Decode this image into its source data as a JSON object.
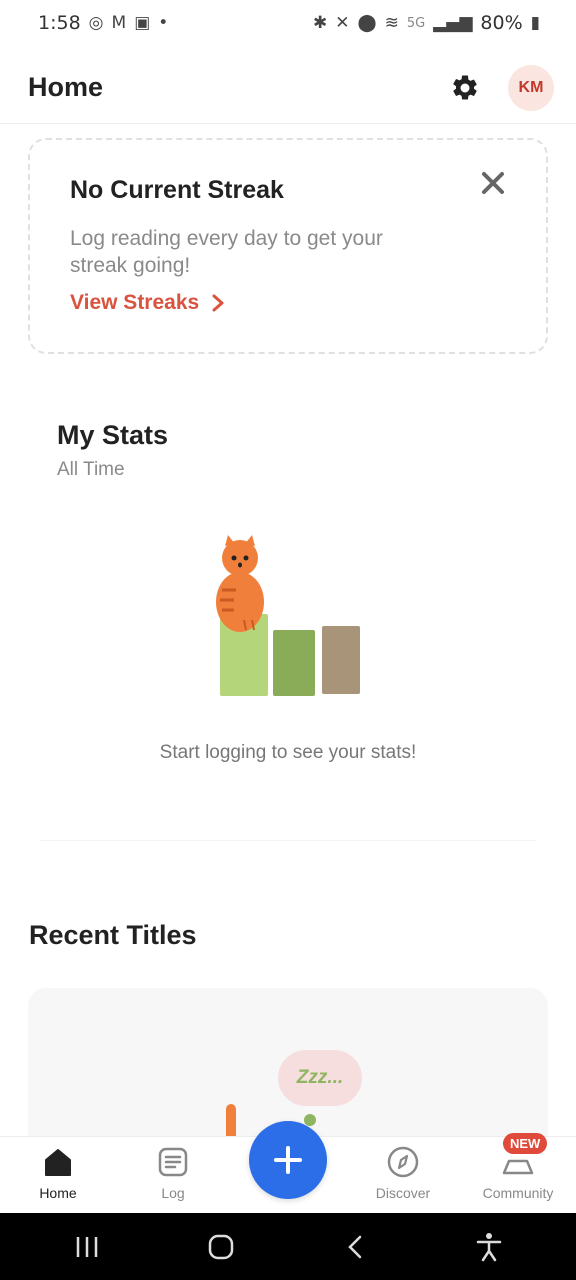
{
  "status_bar": {
    "time": "1:58",
    "network": "5G",
    "battery": "80%"
  },
  "header": {
    "title": "Home",
    "avatar_initials": "KM"
  },
  "streak_card": {
    "title": "No Current Streak",
    "description": "Log reading every day to get your streak going!",
    "link_label": "View Streaks"
  },
  "stats": {
    "title": "My Stats",
    "subtitle": "All Time",
    "empty_message": "Start logging to see your stats!"
  },
  "recent": {
    "title": "Recent Titles",
    "bubble_text": "Zzz..."
  },
  "bottom_nav": {
    "items": [
      {
        "label": "Home",
        "icon": "home-icon",
        "active": true
      },
      {
        "label": "Log",
        "icon": "log-icon",
        "active": false
      },
      {
        "label": "Discover",
        "icon": "compass-icon",
        "active": false
      },
      {
        "label": "Community",
        "icon": "community-icon",
        "active": false
      }
    ],
    "badge": "NEW"
  },
  "colors": {
    "accent": "#d9533f",
    "fab": "#2b6ee8",
    "avatar_bg": "#fbe5e0"
  }
}
